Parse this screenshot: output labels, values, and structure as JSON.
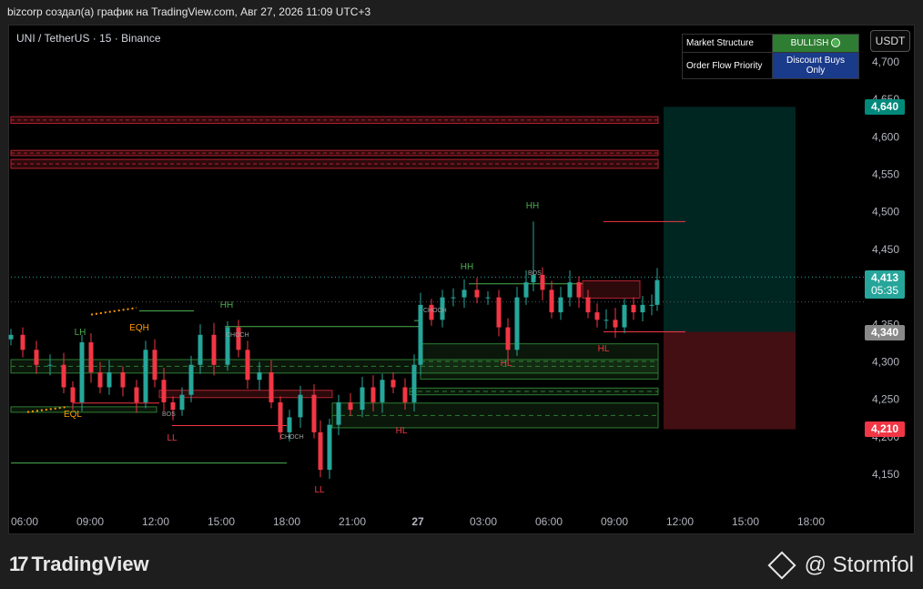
{
  "header": {
    "title": "bizcorp создал(а) график на TradingView.com, Авг 27, 2026 11:09 UTC+3"
  },
  "symbol": {
    "label": "UNI / TetherUS · 15 · Binance"
  },
  "currency": {
    "label": "USDT"
  },
  "table": {
    "row1_label": "Market Structure",
    "row1_value": "BULLISH",
    "row2_label": "Order Flow Priority",
    "row2_value": "Discount Buys Only"
  },
  "price_badges": {
    "target": "4,640",
    "last": "4,413",
    "countdown": "05:35",
    "entry": "4,340",
    "stop": "4,210"
  },
  "footer": {
    "brand": "TradingView",
    "watermark": "@ Stormfol"
  },
  "chart_data": {
    "type": "candlestick",
    "y_ticks": [
      "4,700",
      "4,650",
      "4,600",
      "4,550",
      "4,500",
      "4,450",
      "4,400",
      "4,350",
      "4,300",
      "4,250",
      "4,200",
      "4,150"
    ],
    "x_ticks": [
      "06:00",
      "09:00",
      "12:00",
      "15:00",
      "18:00",
      "21:00",
      "27",
      "03:00",
      "06:00",
      "09:00",
      "12:00",
      "15:00",
      "18:00"
    ],
    "ylim": [
      4.13,
      4.72
    ],
    "annotations": [
      {
        "text": "LH",
        "x": "08:30",
        "y": 4.358,
        "color": "#4caf50"
      },
      {
        "text": "EQH",
        "x": "11:30",
        "y": 4.362,
        "color": "#ff9800"
      },
      {
        "text": "EQL",
        "x": "08:00",
        "y": 4.223,
        "color": "#ff9800"
      },
      {
        "text": "HH",
        "x": "15:15",
        "y": 4.394,
        "color": "#4caf50"
      },
      {
        "text": "LL",
        "x": "13:00",
        "y": 4.213,
        "color": "#f23645"
      },
      {
        "text": "LL",
        "x": "19:15",
        "y": 4.147,
        "color": "#f23645"
      },
      {
        "text": "HL",
        "x": "00:45",
        "y": 4.228,
        "color": "#f23645"
      },
      {
        "text": "HH",
        "x": "02:15",
        "y": 4.438,
        "color": "#4caf50"
      },
      {
        "text": "HL",
        "x": "04:00",
        "y": 4.299,
        "color": "#f23645"
      },
      {
        "text": "HH",
        "x": "05:30",
        "y": 4.505,
        "color": "#4caf50"
      },
      {
        "text": "HL",
        "x": "08:30",
        "y": 4.318,
        "color": "#f23645"
      }
    ]
  }
}
